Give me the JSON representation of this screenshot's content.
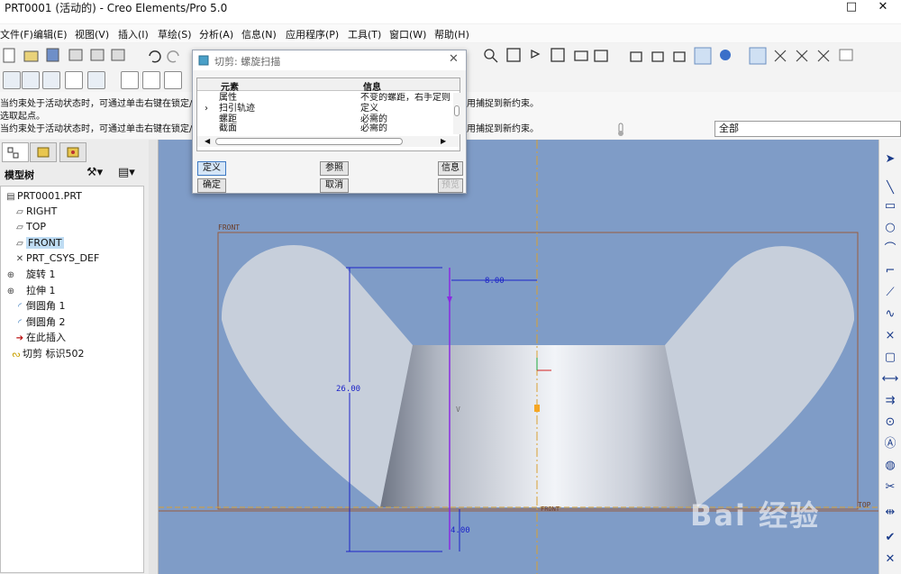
{
  "window": {
    "title": "PRT0001 (活动的) - Creo Elements/Pro 5.0",
    "maximize_glyph": "□",
    "close_glyph": "✕"
  },
  "menu": [
    "文件(F)",
    "编辑(E)",
    "视图(V)",
    "插入(I)",
    "草绘(S)",
    "分析(A)",
    "信息(N)",
    "应用程序(P)",
    "工具(T)",
    "窗口(W)",
    "帮助(H)"
  ],
  "messages": [
    "当约束处于活动状态时，可通过单击右键在锁定/禁",
    "选取起点。",
    "当约束处于活动状态时，可通过单击右键在锁定/禁"
  ],
  "message_tail": "用捕捉到新约束。",
  "filter": {
    "value": "全部"
  },
  "model_tree": {
    "label": "模型树",
    "items": [
      {
        "icon": "part-icon",
        "glyph": "▤",
        "label": "PRT0001.PRT"
      },
      {
        "icon": "datum-plane-icon",
        "glyph": "▱",
        "label": "RIGHT"
      },
      {
        "icon": "datum-plane-icon",
        "glyph": "▱",
        "label": "TOP"
      },
      {
        "icon": "datum-plane-icon",
        "glyph": "▱",
        "label": "FRONT"
      },
      {
        "icon": "csys-icon",
        "glyph": "✕",
        "label": "PRT_CSYS_DEF"
      },
      {
        "icon": "revolve-icon",
        "glyph": "⊕",
        "label": "旋转 1"
      },
      {
        "icon": "extrude-icon",
        "glyph": "⊕",
        "label": "拉伸 1"
      },
      {
        "icon": "round-icon",
        "glyph": "◜",
        "label": "倒圆角 1"
      },
      {
        "icon": "round-icon",
        "glyph": "◜",
        "label": "倒圆角 2"
      },
      {
        "icon": "insert-here-icon",
        "glyph": "➔",
        "label": "在此插入"
      },
      {
        "icon": "helical-sweep-icon",
        "glyph": "ᔓ",
        "label": "切剪 标识502"
      }
    ]
  },
  "dialog": {
    "title": "切剪: 螺旋扫描",
    "col_element": "元素",
    "col_info": "信息",
    "rows": [
      {
        "element": "属性",
        "info": "不变的螺距，右手定则"
      },
      {
        "element": "扫引轨迹",
        "info": "定义"
      },
      {
        "element": "螺距",
        "info": "必需的"
      },
      {
        "element": "截面",
        "info": "必需的"
      }
    ],
    "buttons": {
      "define": "定义",
      "refs": "参照",
      "info": "信息",
      "ok": "确定",
      "cancel": "取消",
      "preview": "预览"
    }
  },
  "sketch": {
    "front_label": "FRONT",
    "front_label_bottom": "FRONT",
    "top_label": "TOP",
    "dim_width": "8.00",
    "dim_height": "26.00",
    "dim_small": "4.00",
    "v_marker": "V"
  },
  "watermark": "Bai 经验",
  "colors": {
    "canvas": "#7f9cc7",
    "part": "#c7cfdb",
    "dim_blue": "#1c23c8",
    "dim_purple": "#8a2be2",
    "centerline": "#d9a032"
  }
}
